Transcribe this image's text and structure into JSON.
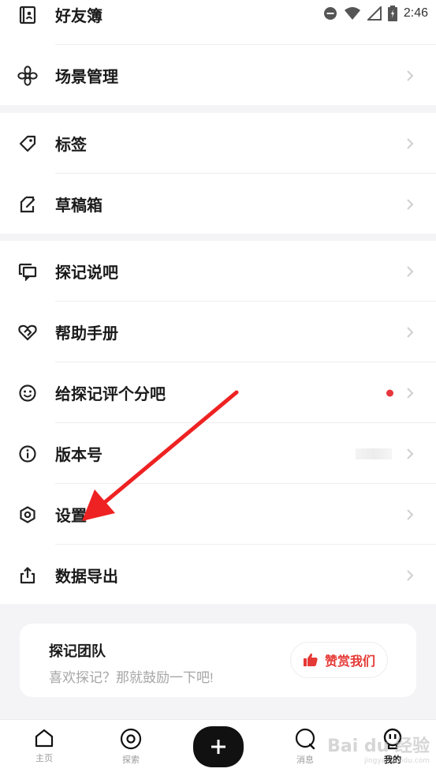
{
  "status_bar": {
    "time": "2:46"
  },
  "groups": [
    {
      "items": [
        {
          "label": "好友簿",
          "icon": "contacts-book-icon"
        },
        {
          "label": "场景管理",
          "icon": "flower-icon"
        }
      ]
    },
    {
      "items": [
        {
          "label": "标签",
          "icon": "tag-icon"
        },
        {
          "label": "草稿箱",
          "icon": "draft-edit-icon"
        }
      ]
    },
    {
      "items": [
        {
          "label": "探记说吧",
          "icon": "chat-bubbles-icon"
        },
        {
          "label": "帮助手册",
          "icon": "heart-handshake-icon"
        },
        {
          "label": "给探记评个分吧",
          "icon": "smile-icon",
          "badge": "red-dot"
        },
        {
          "label": "版本号",
          "icon": "info-icon"
        },
        {
          "label": "设置",
          "icon": "hexagon-settings-icon"
        },
        {
          "label": "数据导出",
          "icon": "share-export-icon"
        }
      ]
    }
  ],
  "team_card": {
    "title": "探记团队",
    "subtitle": "喜欢探记？那就鼓励一下吧!",
    "button_label": "赞赏我们"
  },
  "tabbar": {
    "tabs": [
      {
        "label": "主页",
        "icon": "home-icon"
      },
      {
        "label": "探索",
        "icon": "explore-icon"
      },
      {
        "label": "",
        "icon": "plus-icon"
      },
      {
        "label": "消息",
        "icon": "message-icon"
      },
      {
        "label": "我的",
        "icon": "profile-icon",
        "active": true
      }
    ]
  },
  "watermark": {
    "text": "Bai du 经验",
    "sub": "jingyan.baidu.com"
  },
  "colors": {
    "accent_red": "#e53935",
    "text": "#1a1a1a",
    "muted": "#a6a6a6",
    "background": "#f4f4f6"
  }
}
